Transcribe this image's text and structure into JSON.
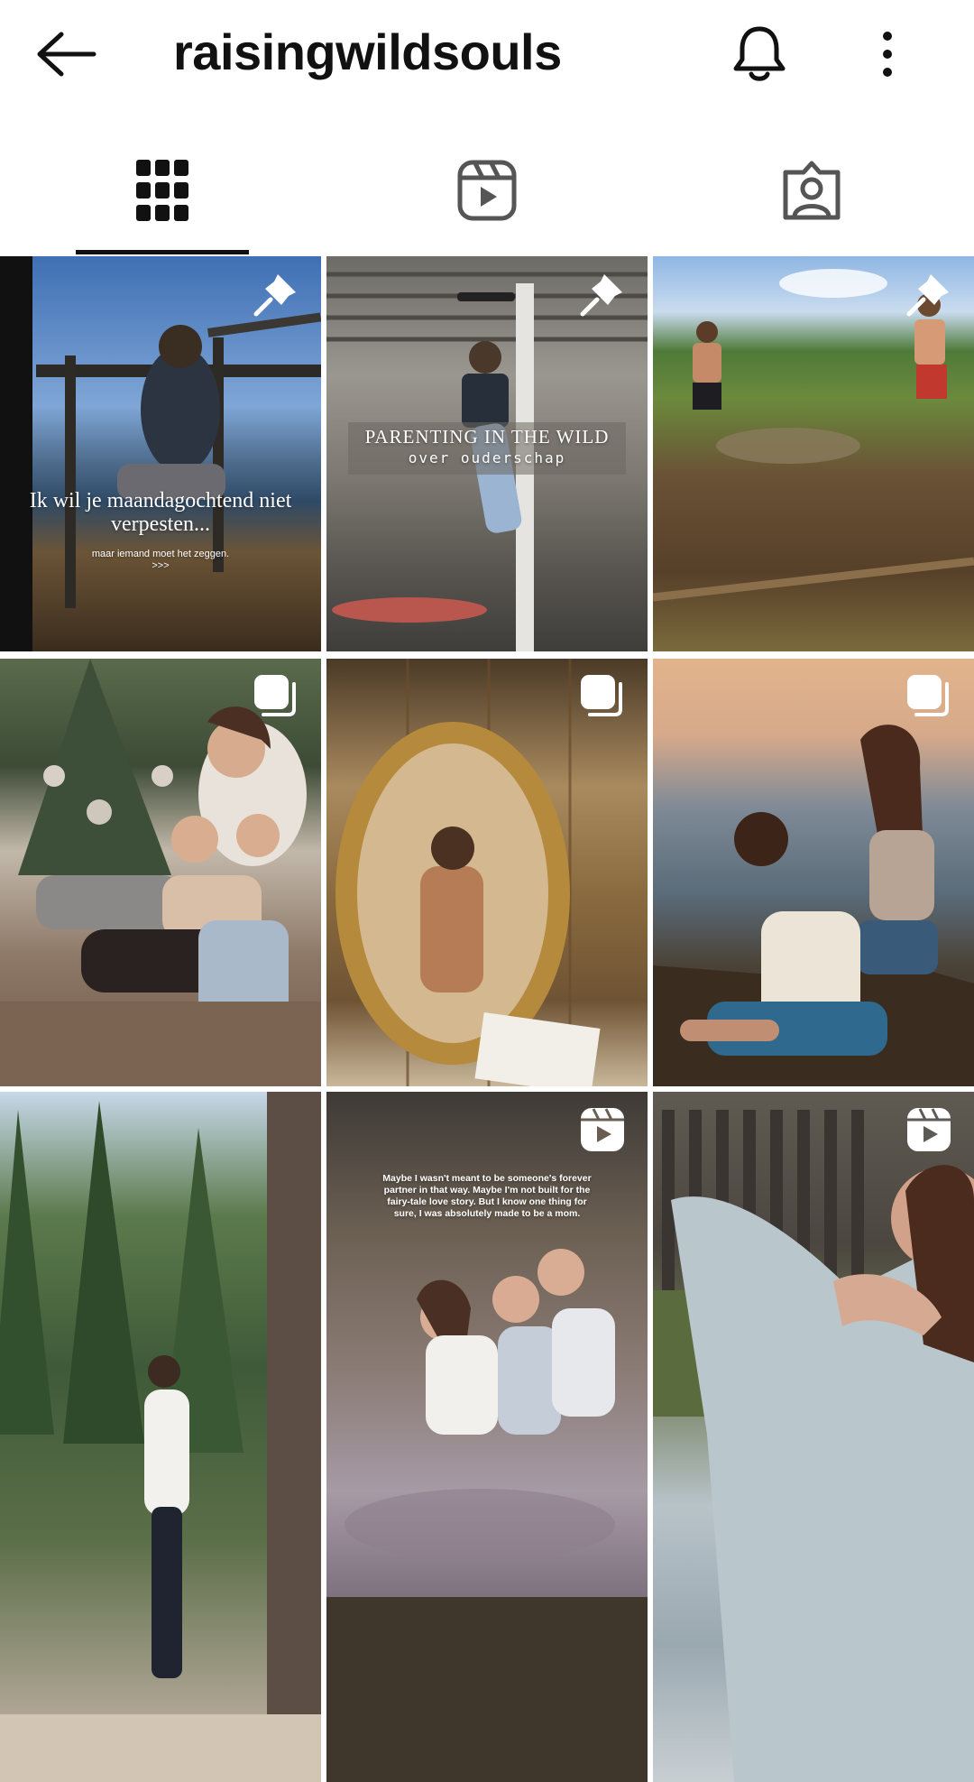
{
  "header": {
    "username": "raisingwildsouls",
    "back_icon": "arrow-left-icon",
    "bell_icon": "bell-icon",
    "more_icon": "more-vertical-icon"
  },
  "tabs": [
    {
      "name": "posts-grid",
      "icon": "grid-icon",
      "selected": true
    },
    {
      "name": "reels",
      "icon": "reels-icon",
      "selected": false
    },
    {
      "name": "tagged",
      "icon": "tagged-person-icon",
      "selected": false
    }
  ],
  "posts": [
    {
      "badge": "pin-icon",
      "overlay_line1": "Ik wil je maandagochtend niet verpesten...",
      "overlay_line2": "maar iemand moet het zeggen.",
      "overlay_line3": ">>>"
    },
    {
      "badge": "pin-icon",
      "overlay_line1": "PARENTING IN THE WILD",
      "overlay_line2": "over ouderschap"
    },
    {
      "badge": "pin-icon"
    },
    {
      "badge": "carousel-icon"
    },
    {
      "badge": "carousel-icon"
    },
    {
      "badge": "carousel-icon"
    },
    {
      "badge": ""
    },
    {
      "badge": "reel-icon",
      "overlay_line1": "Maybe I wasn't meant to be someone's forever partner in that way. Maybe I'm not built for the fairy-tale love story. But I know one thing for sure, I was absolutely made to be a mom."
    },
    {
      "badge": "reel-icon"
    }
  ],
  "colors": {
    "text": "#111111",
    "background": "#ffffff",
    "icon_gray": "#555555"
  }
}
